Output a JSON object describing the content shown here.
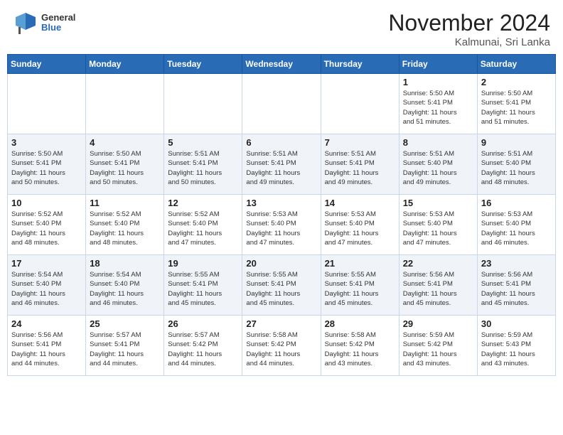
{
  "header": {
    "logo_general": "General",
    "logo_blue": "Blue",
    "month_title": "November 2024",
    "location": "Kalmunai, Sri Lanka"
  },
  "days_of_week": [
    "Sunday",
    "Monday",
    "Tuesday",
    "Wednesday",
    "Thursday",
    "Friday",
    "Saturday"
  ],
  "weeks": [
    [
      {
        "day": "",
        "info": ""
      },
      {
        "day": "",
        "info": ""
      },
      {
        "day": "",
        "info": ""
      },
      {
        "day": "",
        "info": ""
      },
      {
        "day": "",
        "info": ""
      },
      {
        "day": "1",
        "info": "Sunrise: 5:50 AM\nSunset: 5:41 PM\nDaylight: 11 hours\nand 51 minutes."
      },
      {
        "day": "2",
        "info": "Sunrise: 5:50 AM\nSunset: 5:41 PM\nDaylight: 11 hours\nand 51 minutes."
      }
    ],
    [
      {
        "day": "3",
        "info": "Sunrise: 5:50 AM\nSunset: 5:41 PM\nDaylight: 11 hours\nand 50 minutes."
      },
      {
        "day": "4",
        "info": "Sunrise: 5:50 AM\nSunset: 5:41 PM\nDaylight: 11 hours\nand 50 minutes."
      },
      {
        "day": "5",
        "info": "Sunrise: 5:51 AM\nSunset: 5:41 PM\nDaylight: 11 hours\nand 50 minutes."
      },
      {
        "day": "6",
        "info": "Sunrise: 5:51 AM\nSunset: 5:41 PM\nDaylight: 11 hours\nand 49 minutes."
      },
      {
        "day": "7",
        "info": "Sunrise: 5:51 AM\nSunset: 5:41 PM\nDaylight: 11 hours\nand 49 minutes."
      },
      {
        "day": "8",
        "info": "Sunrise: 5:51 AM\nSunset: 5:40 PM\nDaylight: 11 hours\nand 49 minutes."
      },
      {
        "day": "9",
        "info": "Sunrise: 5:51 AM\nSunset: 5:40 PM\nDaylight: 11 hours\nand 48 minutes."
      }
    ],
    [
      {
        "day": "10",
        "info": "Sunrise: 5:52 AM\nSunset: 5:40 PM\nDaylight: 11 hours\nand 48 minutes."
      },
      {
        "day": "11",
        "info": "Sunrise: 5:52 AM\nSunset: 5:40 PM\nDaylight: 11 hours\nand 48 minutes."
      },
      {
        "day": "12",
        "info": "Sunrise: 5:52 AM\nSunset: 5:40 PM\nDaylight: 11 hours\nand 47 minutes."
      },
      {
        "day": "13",
        "info": "Sunrise: 5:53 AM\nSunset: 5:40 PM\nDaylight: 11 hours\nand 47 minutes."
      },
      {
        "day": "14",
        "info": "Sunrise: 5:53 AM\nSunset: 5:40 PM\nDaylight: 11 hours\nand 47 minutes."
      },
      {
        "day": "15",
        "info": "Sunrise: 5:53 AM\nSunset: 5:40 PM\nDaylight: 11 hours\nand 47 minutes."
      },
      {
        "day": "16",
        "info": "Sunrise: 5:53 AM\nSunset: 5:40 PM\nDaylight: 11 hours\nand 46 minutes."
      }
    ],
    [
      {
        "day": "17",
        "info": "Sunrise: 5:54 AM\nSunset: 5:40 PM\nDaylight: 11 hours\nand 46 minutes."
      },
      {
        "day": "18",
        "info": "Sunrise: 5:54 AM\nSunset: 5:40 PM\nDaylight: 11 hours\nand 46 minutes."
      },
      {
        "day": "19",
        "info": "Sunrise: 5:55 AM\nSunset: 5:41 PM\nDaylight: 11 hours\nand 45 minutes."
      },
      {
        "day": "20",
        "info": "Sunrise: 5:55 AM\nSunset: 5:41 PM\nDaylight: 11 hours\nand 45 minutes."
      },
      {
        "day": "21",
        "info": "Sunrise: 5:55 AM\nSunset: 5:41 PM\nDaylight: 11 hours\nand 45 minutes."
      },
      {
        "day": "22",
        "info": "Sunrise: 5:56 AM\nSunset: 5:41 PM\nDaylight: 11 hours\nand 45 minutes."
      },
      {
        "day": "23",
        "info": "Sunrise: 5:56 AM\nSunset: 5:41 PM\nDaylight: 11 hours\nand 45 minutes."
      }
    ],
    [
      {
        "day": "24",
        "info": "Sunrise: 5:56 AM\nSunset: 5:41 PM\nDaylight: 11 hours\nand 44 minutes."
      },
      {
        "day": "25",
        "info": "Sunrise: 5:57 AM\nSunset: 5:41 PM\nDaylight: 11 hours\nand 44 minutes."
      },
      {
        "day": "26",
        "info": "Sunrise: 5:57 AM\nSunset: 5:42 PM\nDaylight: 11 hours\nand 44 minutes."
      },
      {
        "day": "27",
        "info": "Sunrise: 5:58 AM\nSunset: 5:42 PM\nDaylight: 11 hours\nand 44 minutes."
      },
      {
        "day": "28",
        "info": "Sunrise: 5:58 AM\nSunset: 5:42 PM\nDaylight: 11 hours\nand 43 minutes."
      },
      {
        "day": "29",
        "info": "Sunrise: 5:59 AM\nSunset: 5:42 PM\nDaylight: 11 hours\nand 43 minutes."
      },
      {
        "day": "30",
        "info": "Sunrise: 5:59 AM\nSunset: 5:43 PM\nDaylight: 11 hours\nand 43 minutes."
      }
    ]
  ]
}
